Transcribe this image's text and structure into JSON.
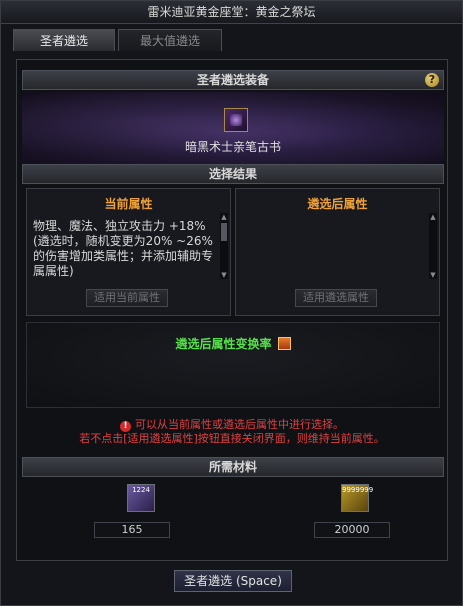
{
  "window": {
    "title": "雷米迪亚黄金座堂：黄金之祭坛"
  },
  "tabs": [
    {
      "label": "圣者遴选",
      "active": true
    },
    {
      "label": "最大值遴选",
      "active": false
    }
  ],
  "equipment": {
    "header": "圣者遴选装备",
    "help_label": "?",
    "item_name": "暗黑术士亲笔古书",
    "item_icon": "dark-book-icon"
  },
  "result": {
    "header": "选择结果",
    "current": {
      "title": "当前属性",
      "text": "物理、魔法、独立攻击力 +18% (遴选时，随机变更为20% ~26%的伤害增加类属性；并添加辅助专属属性)",
      "button": "适用当前属性"
    },
    "after": {
      "title": "遴选后属性",
      "text": "",
      "button": "适用遴选属性"
    }
  },
  "rate": {
    "label": "遴选后属性变换率"
  },
  "warning": {
    "line1": "可以从当前属性或遴选后属性中进行选择。",
    "line2": "若不点击[适用遴选属性]按钮直接关闭界面，则维持当前属性。"
  },
  "materials": {
    "header": "所需材料",
    "items": [
      {
        "icon": "card-material-icon",
        "icon_text": "1224",
        "count": "165"
      },
      {
        "icon": "gold-coins-icon",
        "icon_text": "9999999",
        "count": "20000"
      }
    ]
  },
  "action": {
    "label": "圣者遴选 (Space)"
  },
  "colors": {
    "accent_orange": "#f0a23a",
    "green": "#57e14a",
    "warning_red": "#e04040"
  }
}
